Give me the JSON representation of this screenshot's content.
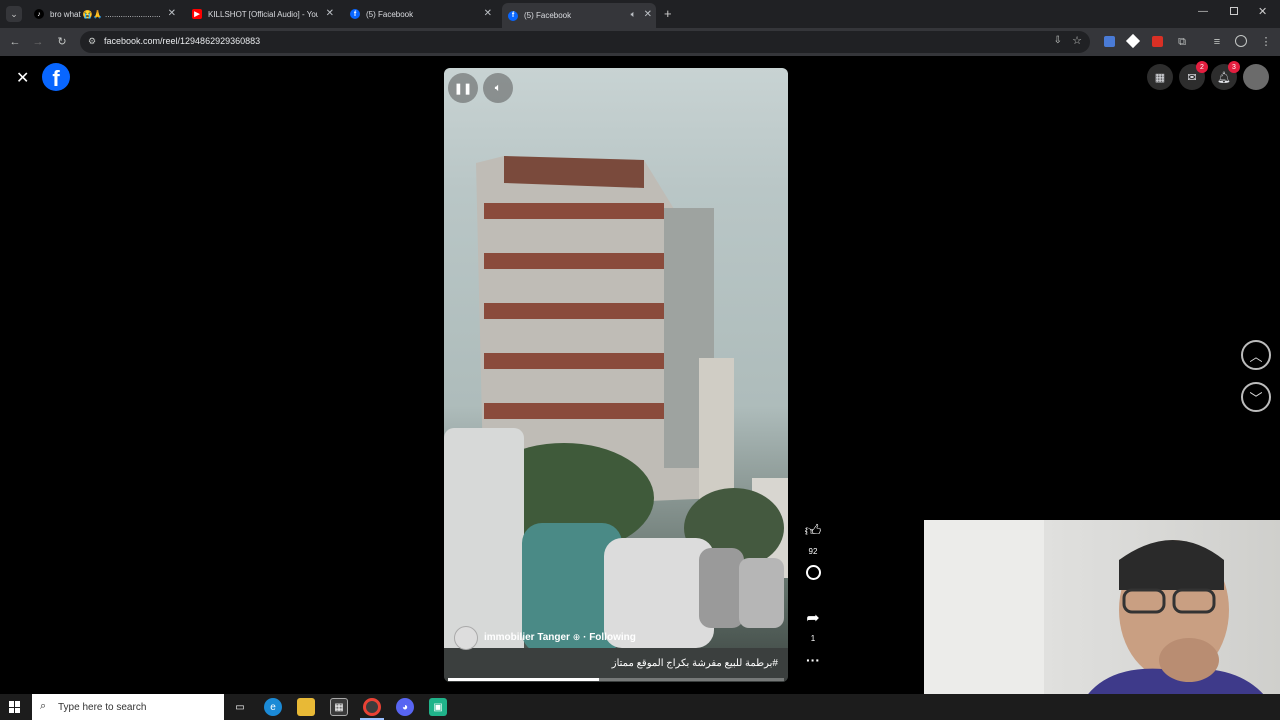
{
  "browser": {
    "tabs": [
      {
        "title": "bro what 😭🙏 ..........................#fy",
        "icon": "tiktok-icon",
        "active": false
      },
      {
        "title": "KILLSHOT [Official Audio] - You",
        "icon": "youtube-icon",
        "active": false
      },
      {
        "title": "(5) Facebook",
        "icon": "facebook-icon",
        "active": false
      },
      {
        "title": "(5) Facebook",
        "icon": "facebook-icon",
        "active": true
      }
    ],
    "url": "facebook.com/reel/1294862929360883"
  },
  "facebook": {
    "notifications": {
      "messenger_badge": "2",
      "bell_badge": "3"
    }
  },
  "reel": {
    "author": "immobilier Tanger",
    "following_label": "Following",
    "separator": "·",
    "caption": "#برطمة للبيع مفرشة بكراج الموقع ممتاز",
    "progress_fraction": 0.45,
    "likes": "92",
    "shares": "1"
  },
  "taskbar": {
    "search_placeholder": "Type here to search"
  },
  "colors": {
    "facebook_blue": "#0866ff",
    "badge_red": "#e41e3f",
    "youtube_red": "#ff0000"
  }
}
